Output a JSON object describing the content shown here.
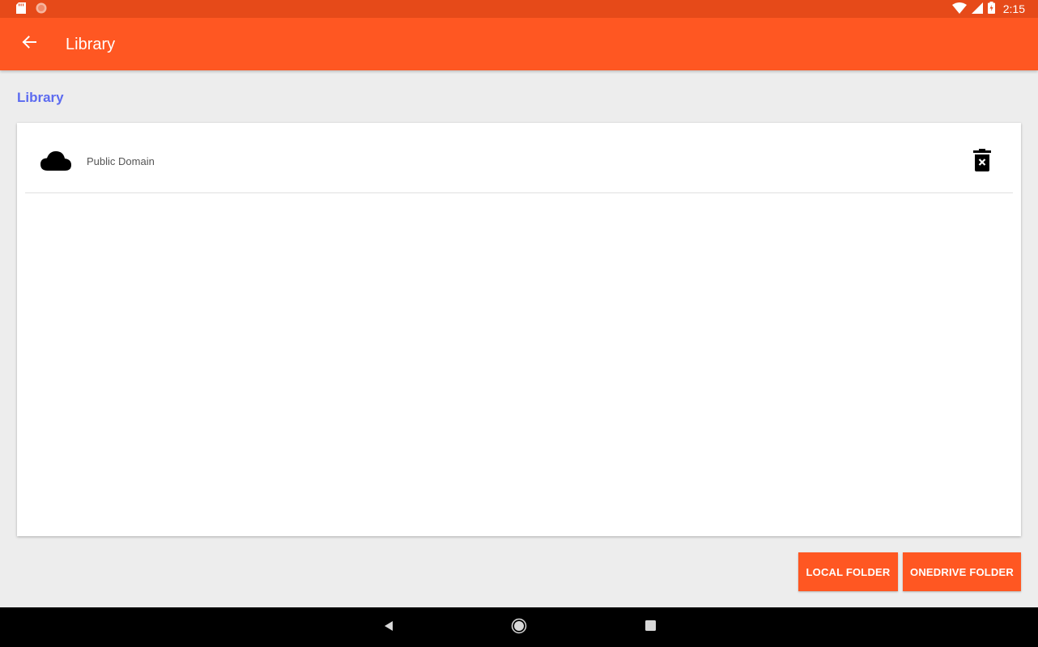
{
  "status_bar": {
    "time": "2:15",
    "left_icons": [
      "sd-card-icon",
      "notification-dot-icon"
    ],
    "right_icons": [
      "wifi-icon",
      "signal-icon",
      "battery-charging-icon"
    ]
  },
  "app_bar": {
    "title": "Library",
    "back_icon": "arrow-back-icon",
    "background_color": "#ff5722",
    "status_color": "#e64a19"
  },
  "section": {
    "title": "Library",
    "title_color": "#5c6bf0"
  },
  "library_items": [
    {
      "icon": "cloud-icon",
      "label": "Public Domain",
      "action_icon": "delete-icon"
    }
  ],
  "buttons": {
    "local_folder": "LOCAL FOLDER",
    "onedrive_folder": "ONEDRIVE FOLDER"
  },
  "nav_bar": {
    "items": [
      "nav-back-icon",
      "nav-home-icon",
      "nav-recents-icon"
    ]
  }
}
